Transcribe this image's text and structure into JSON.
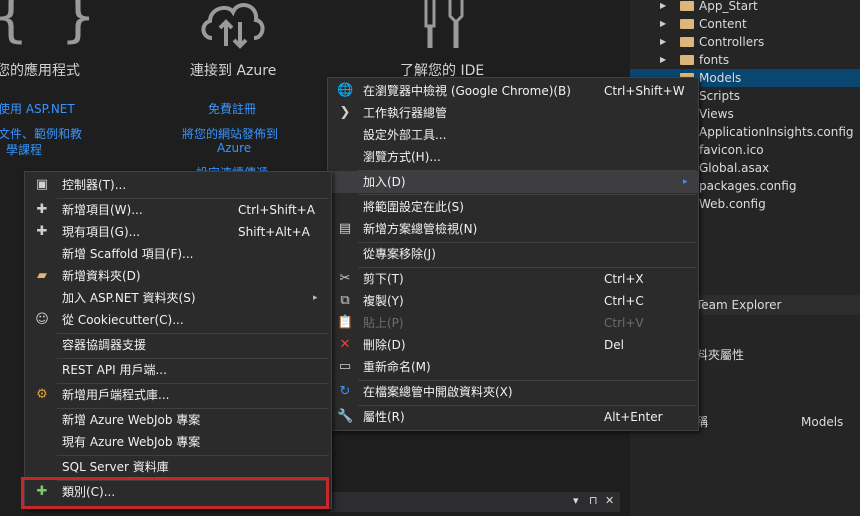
{
  "start_page": {
    "col1_title": "您的應用程式",
    "col1_links": [
      "使用 ASP.NET",
      "文件、範例和教",
      "學課程"
    ],
    "col2_title": "連接到 Azure",
    "col2_links": [
      "免費註冊",
      "將您的網站發佈到",
      "Azure",
      "設定連續傳遞"
    ],
    "col3_title": "了解您的 IDE"
  },
  "solution_explorer": {
    "items": [
      {
        "label": "App_Start",
        "folder": true
      },
      {
        "label": "Content",
        "folder": true
      },
      {
        "label": "Controllers",
        "folder": true
      },
      {
        "label": "fonts",
        "folder": true
      },
      {
        "label": "Models",
        "folder": true
      },
      {
        "label": "Scripts",
        "folder": false
      },
      {
        "label": "Views",
        "folder": false
      },
      {
        "label": "ApplicationInsights.config",
        "folder": false
      },
      {
        "label": "favicon.ico",
        "folder": false
      },
      {
        "label": "Global.asax",
        "folder": false
      },
      {
        "label": "packages.config",
        "folder": false
      },
      {
        "label": "Web.config",
        "folder": false
      }
    ]
  },
  "team_explorer_label": "Team Explorer",
  "properties": {
    "header": "料夾屬性",
    "row_name": "稱",
    "row_value": "Models"
  },
  "bottom_bar_icons": [
    "▾",
    "⊓",
    "✕"
  ],
  "context_menu": {
    "items": [
      {
        "icon": "🌐",
        "label": "在瀏覽器中檢視 (Google Chrome)(B)",
        "shortcut": "Ctrl+Shift+W"
      },
      {
        "icon": "❯",
        "label": "工作執行器總管",
        "shortcut": ""
      },
      {
        "icon": "",
        "label": "設定外部工具...",
        "shortcut": ""
      },
      {
        "icon": "",
        "label": "瀏覽方式(H)...",
        "shortcut": ""
      },
      {
        "icon": "",
        "label": "加入(D)",
        "shortcut": "",
        "submenu": true
      },
      {
        "icon": "",
        "label": "將範圍設定在此(S)",
        "shortcut": ""
      },
      {
        "icon": "▤",
        "label": "新增方案總管檢視(N)",
        "shortcut": ""
      },
      {
        "icon": "",
        "label": "從專案移除(J)",
        "shortcut": ""
      },
      {
        "icon": "✂",
        "label": "剪下(T)",
        "shortcut": "Ctrl+X"
      },
      {
        "icon": "⧉",
        "label": "複製(Y)",
        "shortcut": "Ctrl+C"
      },
      {
        "icon": "📋",
        "label": "貼上(P)",
        "shortcut": "Ctrl+V",
        "disabled": true
      },
      {
        "icon": "✕",
        "label": "刪除(D)",
        "shortcut": "Del"
      },
      {
        "icon": "▭",
        "label": "重新命名(M)",
        "shortcut": ""
      },
      {
        "icon": "↻",
        "label": "在檔案總管中開啟資料夾(X)",
        "shortcut": ""
      },
      {
        "icon": "🔧",
        "label": "屬性(R)",
        "shortcut": "Alt+Enter"
      }
    ],
    "submenu_arrow": "▸"
  },
  "add_submenu": {
    "items": [
      {
        "icon": "▣",
        "label": "控制器(T)...",
        "shortcut": ""
      },
      {
        "icon": "✚",
        "label": "新增項目(W)...",
        "shortcut": "Ctrl+Shift+A"
      },
      {
        "icon": "✚",
        "label": "現有項目(G)...",
        "shortcut": "Shift+Alt+A"
      },
      {
        "icon": "",
        "label": "新增 Scaffold 項目(F)...",
        "shortcut": ""
      },
      {
        "icon": "▰",
        "label": "新增資料夾(D)",
        "shortcut": ""
      },
      {
        "icon": "",
        "label": "加入 ASP.NET 資料夾(S)",
        "shortcut": "",
        "submenu": true
      },
      {
        "icon": "☺",
        "label": "從 Cookiecutter(C)...",
        "shortcut": ""
      },
      {
        "icon": "",
        "label": "容器協調器支援",
        "shortcut": ""
      },
      {
        "icon": "",
        "label": "REST API 用戶端...",
        "shortcut": ""
      },
      {
        "icon": "⚙",
        "label": "新增用戶端程式庫...",
        "shortcut": ""
      },
      {
        "icon": "",
        "label": "新增 Azure WebJob 專案",
        "shortcut": ""
      },
      {
        "icon": "",
        "label": "現有 Azure WebJob 專案",
        "shortcut": ""
      },
      {
        "icon": "",
        "label": "SQL Server 資料庫",
        "shortcut": ""
      },
      {
        "icon": "✚",
        "label": "類別(C)...",
        "shortcut": ""
      }
    ],
    "submenu_arrow": "▸"
  },
  "colors": {
    "highlight_box": "#c4282d",
    "link": "#3794ff",
    "selection": "#094771"
  }
}
